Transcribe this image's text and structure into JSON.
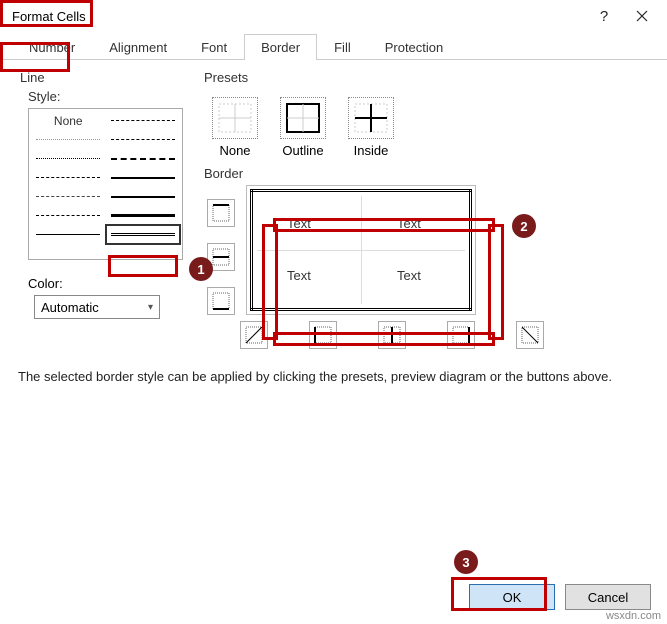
{
  "titlebar": {
    "title": "Format Cells"
  },
  "tabs": {
    "items": [
      {
        "label": "Number"
      },
      {
        "label": "Alignment"
      },
      {
        "label": "Font"
      },
      {
        "label": "Border"
      },
      {
        "label": "Fill"
      },
      {
        "label": "Protection"
      }
    ],
    "active_index": 3
  },
  "line": {
    "section": "Line",
    "style_label": "Style:",
    "none_label": "None",
    "color_label": "Color:",
    "color_value": "Automatic"
  },
  "presets": {
    "section": "Presets",
    "items": [
      {
        "label": "None"
      },
      {
        "label": "Outline"
      },
      {
        "label": "Inside"
      }
    ]
  },
  "border": {
    "section": "Border",
    "preview_text": "Text"
  },
  "description": "The selected border style can be applied by clicking the presets, preview diagram or the buttons above.",
  "footer": {
    "ok": "OK",
    "cancel": "Cancel"
  },
  "annotations": {
    "badges": [
      "1",
      "2",
      "3"
    ]
  },
  "watermark": "wsxdn.com"
}
